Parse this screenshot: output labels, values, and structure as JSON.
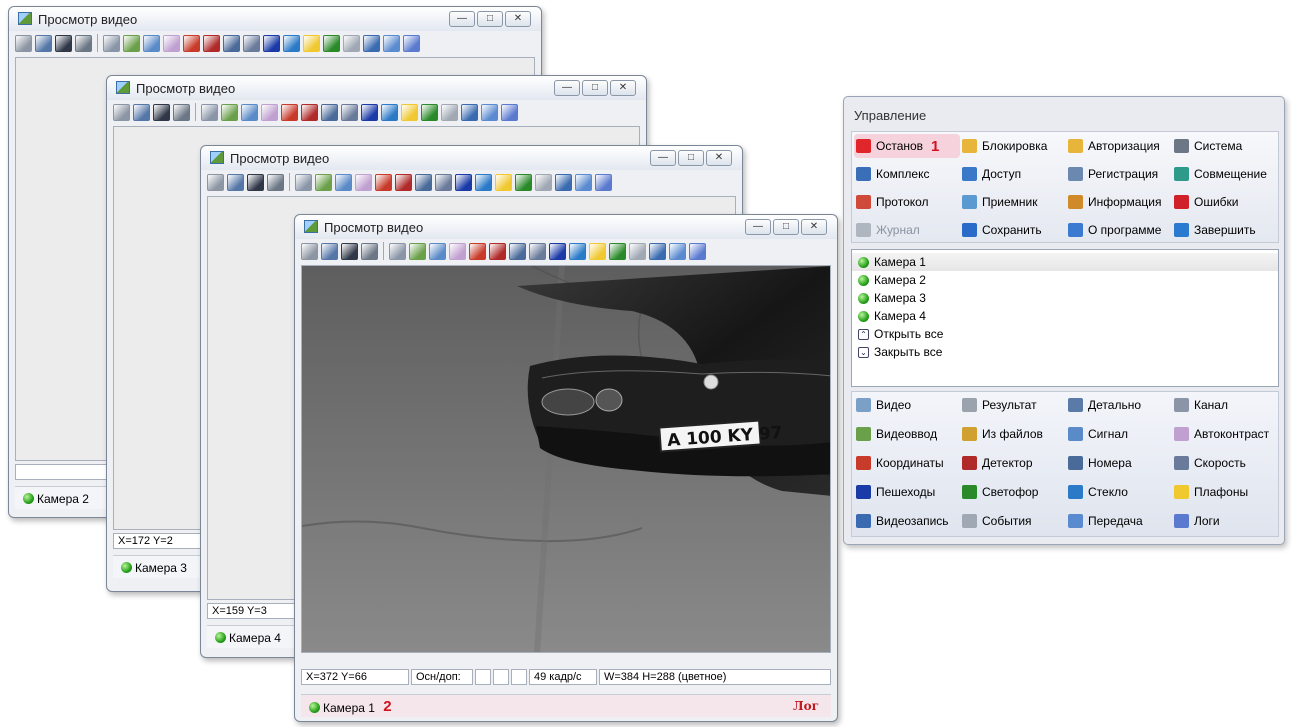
{
  "window_title": "Просмотр видео",
  "windows": [
    {
      "camera": "Камера 2",
      "coords": ""
    },
    {
      "camera": "Камера 3",
      "coords": "X=172 Y=2"
    },
    {
      "camera": "Камера 4",
      "coords": "X=159 Y=3"
    },
    {
      "camera": "Камера 1",
      "coords": "X=372 Y=66",
      "mode": "Осн/доп:",
      "fps": "49 кадр/с",
      "size": "W=384 H=288 (цветное)",
      "badge": "2",
      "log": "Лог"
    }
  ],
  "plate_text": "A 100 KY 97",
  "control": {
    "title": "Управление",
    "badge": "1",
    "top_items": [
      {
        "label": "Останов",
        "icon": "stop-icon",
        "color": "#e0262b"
      },
      {
        "label": "Блокировка",
        "icon": "lock-icon",
        "color": "#e7b53a"
      },
      {
        "label": "Авторизация",
        "icon": "key-icon",
        "color": "#e7b53a"
      },
      {
        "label": "Система",
        "icon": "tools-icon",
        "color": "#6b7785"
      },
      {
        "label": "Комплекс",
        "icon": "computer-icon",
        "color": "#3a6fb8"
      },
      {
        "label": "Доступ",
        "icon": "users-icon",
        "color": "#3a78c8"
      },
      {
        "label": "Регистрация",
        "icon": "register-key-icon",
        "color": "#6a88b0"
      },
      {
        "label": "Совмещение",
        "icon": "align-icon",
        "color": "#2e9a8a"
      },
      {
        "label": "Протокол",
        "icon": "protocol-icon",
        "color": "#d04a3a"
      },
      {
        "label": "Приемник",
        "icon": "receiver-icon",
        "color": "#5a9ad0"
      },
      {
        "label": "Информация",
        "icon": "info-person-icon",
        "color": "#d08a2a"
      },
      {
        "label": "Ошибки",
        "icon": "error-icon",
        "color": "#d0202a"
      },
      {
        "label": "Журнал",
        "icon": "journal-icon",
        "color": "#b0b6c0"
      },
      {
        "label": "Сохранить",
        "icon": "save-icon",
        "color": "#2a6ac8"
      },
      {
        "label": "О программе",
        "icon": "about-icon",
        "color": "#3a7ad0"
      },
      {
        "label": "Завершить",
        "icon": "exit-icon",
        "color": "#2a7ad0"
      }
    ],
    "cameras": [
      "Камера 1",
      "Камера 2",
      "Камера 3",
      "Камера 4"
    ],
    "open_all": "Открыть все",
    "close_all": "Закрыть все",
    "bottom_items": [
      {
        "label": "Видео",
        "icon": "video-icon",
        "color": "#7aa0c8"
      },
      {
        "label": "Результат",
        "icon": "result-icon",
        "color": "#9aa2ae"
      },
      {
        "label": "Детально",
        "icon": "zoom-icon",
        "color": "#5a7aa8"
      },
      {
        "label": "Канал",
        "icon": "channel-icon",
        "color": "#8a96a8"
      },
      {
        "label": "Видеоввод",
        "icon": "video-input-icon",
        "color": "#6aa04a"
      },
      {
        "label": "Из файлов",
        "icon": "from-files-icon",
        "color": "#d0a030"
      },
      {
        "label": "Сигнал",
        "icon": "signal-icon",
        "color": "#5a8ac8"
      },
      {
        "label": "Автоконтраст",
        "icon": "autocontrast-icon",
        "color": "#c0a0d0"
      },
      {
        "label": "Координаты",
        "icon": "coordinates-icon",
        "color": "#c83a2a"
      },
      {
        "label": "Детектор",
        "icon": "detector-icon",
        "color": "#b02a2a"
      },
      {
        "label": "Номера",
        "icon": "plates-icon",
        "color": "#4a6a9a"
      },
      {
        "label": "Скорость",
        "icon": "speed-icon",
        "color": "#6a7a9a"
      },
      {
        "label": "Пешеходы",
        "icon": "pedestrian-icon",
        "color": "#1a3aa8"
      },
      {
        "label": "Светофор",
        "icon": "traffic-light-icon",
        "color": "#2a8a2a"
      },
      {
        "label": "Стекло",
        "icon": "glass-icon",
        "color": "#2a7ac8"
      },
      {
        "label": "Плафоны",
        "icon": "bulb-icon",
        "color": "#f0c830"
      },
      {
        "label": "Видеозапись",
        "icon": "recording-icon",
        "color": "#3a6ab0"
      },
      {
        "label": "События",
        "icon": "bell-icon",
        "color": "#a0a8b4"
      },
      {
        "label": "Передача",
        "icon": "transfer-icon",
        "color": "#5a8ad0"
      },
      {
        "label": "Логи",
        "icon": "logs-icon",
        "color": "#5a7ad0"
      }
    ]
  },
  "toolbar_icons": [
    {
      "name": "result-tool-icon",
      "color": "#8c95a3"
    },
    {
      "name": "zoom-tool-icon",
      "color": "#5577a8"
    },
    {
      "name": "text-tool-icon",
      "color": "#303848"
    },
    {
      "name": "system-tool-icon",
      "color": "#6b7785"
    },
    {
      "name": "channel-tool-icon",
      "color": "#8a96a8"
    },
    {
      "name": "video-input-tool-icon",
      "color": "#6aa04a"
    },
    {
      "name": "signal-tool-icon",
      "color": "#5a8ac8"
    },
    {
      "name": "autocontrast-tool-icon",
      "color": "#c0a0d0"
    },
    {
      "name": "coordinates-tool-icon",
      "color": "#c83a2a"
    },
    {
      "name": "detector-tool-icon",
      "color": "#b02a2a"
    },
    {
      "name": "plates-tool-icon",
      "color": "#4a6a9a"
    },
    {
      "name": "speed-tool-icon",
      "color": "#6a7a9a"
    },
    {
      "name": "pedestrian-tool-icon",
      "color": "#1a3aa8"
    },
    {
      "name": "glass-tool-icon",
      "color": "#2a7ac8"
    },
    {
      "name": "bulb-tool-icon",
      "color": "#f0c830"
    },
    {
      "name": "traffic-light-tool-icon",
      "color": "#2a8a2a"
    },
    {
      "name": "bell-tool-icon",
      "color": "#a0a8b4"
    },
    {
      "name": "recording-tool-icon",
      "color": "#3a6ab0"
    },
    {
      "name": "transfer-tool-icon",
      "color": "#5a8ad0"
    },
    {
      "name": "logs-tool-icon",
      "color": "#5a7ad0"
    }
  ]
}
